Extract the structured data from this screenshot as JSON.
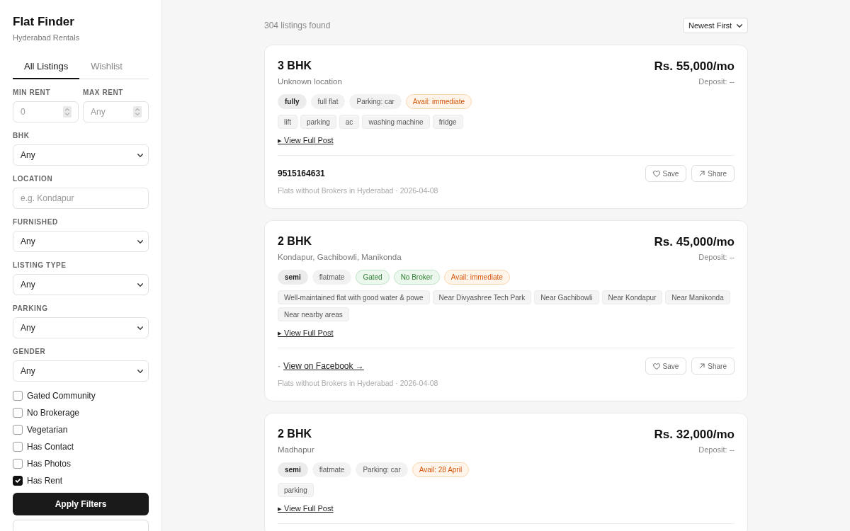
{
  "sidebar": {
    "title": "Flat Finder",
    "subtitle": "Hyderabad Rentals",
    "tabs": [
      {
        "label": "All Listings",
        "selected": true
      },
      {
        "label": "Wishlist",
        "selected": false
      }
    ],
    "rent_range": [
      {
        "label": "MIN RENT",
        "placeholder": "0"
      },
      {
        "label": "MAX RENT",
        "placeholder": "Any"
      }
    ],
    "filters": [
      {
        "kind": "select",
        "label": "BHK",
        "value": "Any"
      },
      {
        "kind": "text",
        "label": "LOCATION",
        "placeholder": "e.g. Kondapur"
      },
      {
        "kind": "select",
        "label": "FURNISHED",
        "value": "Any"
      },
      {
        "kind": "select",
        "label": "LISTING TYPE",
        "value": "Any"
      },
      {
        "kind": "select",
        "label": "PARKING",
        "value": "Any"
      },
      {
        "kind": "select",
        "label": "GENDER",
        "value": "Any"
      }
    ],
    "toggles": [
      {
        "label": "Gated Community",
        "checked": false
      },
      {
        "label": "No Brokerage",
        "checked": false
      },
      {
        "label": "Vegetarian",
        "checked": false
      },
      {
        "label": "Has Contact",
        "checked": false
      },
      {
        "label": "Has Photos",
        "checked": false
      },
      {
        "label": "Has Rent",
        "checked": true
      }
    ],
    "buttons": [
      {
        "kind": "primary",
        "label": "Apply Filters"
      },
      {
        "kind": "secondary"
      }
    ]
  },
  "results": {
    "count": "304 listings found",
    "sort": "Newest First"
  },
  "listings": [
    {
      "title": "3 BHK",
      "location": "Unknown location",
      "price": "Rs. 55,000/mo",
      "deposit": "Deposit: --",
      "chips": [
        {
          "kind": "furnishing",
          "text": "fully"
        },
        {
          "kind": "plain",
          "text": "full flat"
        },
        {
          "kind": "plain",
          "text": "Parking: car"
        },
        {
          "kind": "availability",
          "text": "Avail: immediate"
        }
      ],
      "tags": [
        "lift",
        "parking",
        "ac",
        "washing machine",
        "fridge"
      ],
      "details_link": "▸ View Full Post",
      "contact": {
        "kind": "phone",
        "text": "9515164631"
      },
      "actions": [
        {
          "kind": "save",
          "label": "Save"
        },
        {
          "kind": "share",
          "label": "Share"
        }
      ],
      "source": "Flats without Brokers in Hyderabad · 2026-04-08"
    },
    {
      "title": "2 BHK",
      "location": "Kondapur, Gachibowli, Manikonda",
      "price": "Rs. 45,000/mo",
      "deposit": "Deposit: --",
      "chips": [
        {
          "kind": "furnishing",
          "text": "semi"
        },
        {
          "kind": "plain",
          "text": "flatmate"
        },
        {
          "kind": "positive",
          "text": "Gated"
        },
        {
          "kind": "positive",
          "text": "No Broker"
        },
        {
          "kind": "availability",
          "text": "Avail: immediate"
        }
      ],
      "tags": [
        "Well-maintained flat with good water & powe",
        "Near Divyashree Tech Park",
        "Near Gachibowli",
        "Near Kondapur",
        "Near Manikonda",
        "Near nearby areas"
      ],
      "details_link": "▸ View Full Post",
      "contact": {
        "kind": "link",
        "lead": "·",
        "text": "View on Facebook →"
      },
      "actions": [
        {
          "kind": "save",
          "label": "Save"
        },
        {
          "kind": "share",
          "label": "Share"
        }
      ],
      "source": "Flats without Brokers in Hyderabad · 2026-04-08"
    },
    {
      "title": "2 BHK",
      "location": "Madhapur",
      "price": "Rs. 32,000/mo",
      "deposit": "Deposit: --",
      "chips": [
        {
          "kind": "furnishing",
          "text": "semi"
        },
        {
          "kind": "plain",
          "text": "flatmate"
        },
        {
          "kind": "plain",
          "text": "Parking: car"
        },
        {
          "kind": "availability",
          "text": "Avail: 28 April"
        }
      ],
      "tags": [
        "parking"
      ],
      "details_link": "▸ View Full Post"
    }
  ]
}
